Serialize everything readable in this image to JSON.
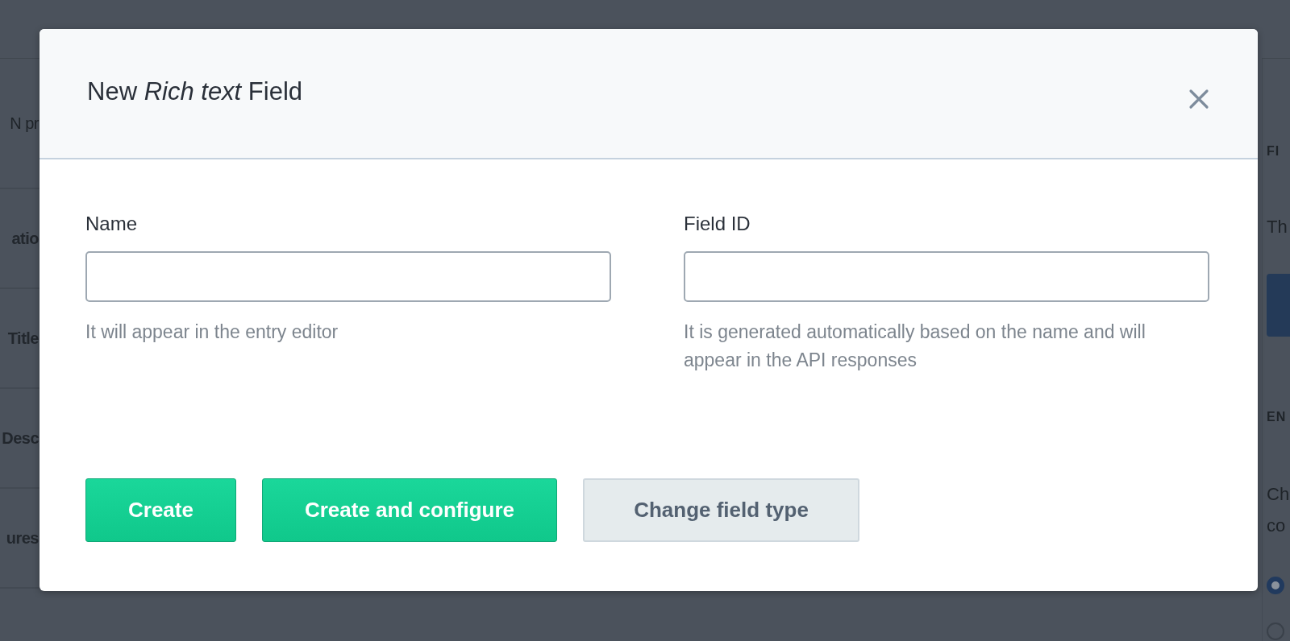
{
  "background_left": [
    "N pr",
    "atio",
    "Title",
    "Desc",
    "ures"
  ],
  "background_right": {
    "section_1": "FI",
    "text_1": "Th",
    "section_2": "EN",
    "text_2": "Ch",
    "text_3": "co",
    "radios": [
      {
        "selected": true
      },
      {
        "selected": false
      }
    ]
  },
  "dialog": {
    "title": "New *Rich text* Field",
    "fields": [
      {
        "label": "Name",
        "help": "It will appear in the entry editor"
      },
      {
        "label": "Field ID",
        "help": "It is generated automatically based on the name and will appear in the API responses"
      }
    ],
    "buttons": [
      {
        "label": "Create",
        "kind": "primary"
      },
      {
        "label": "Create and configure",
        "kind": "primary"
      },
      {
        "label": "Change field type",
        "kind": "secondary"
      }
    ]
  }
}
